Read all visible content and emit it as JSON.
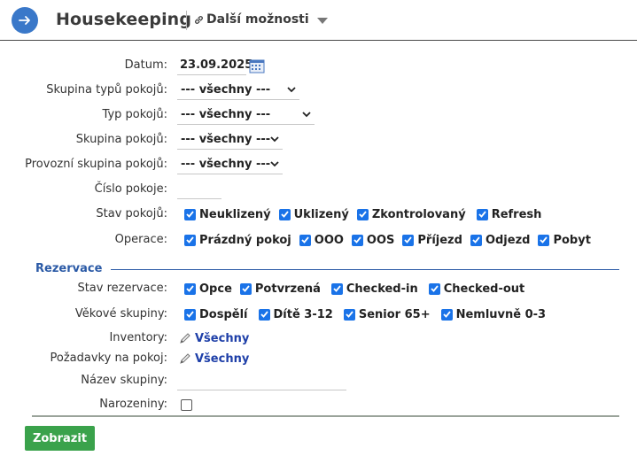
{
  "header": {
    "back_icon": "arrow-right-icon",
    "title": "Housekeeping",
    "more_label": "Další možnosti"
  },
  "filters": {
    "datum": {
      "label": "Datum:",
      "value": "23.09.2025"
    },
    "skupina_typu": {
      "label": "Skupina typů pokojů:",
      "value": "--- všechny ---"
    },
    "typ_pokoju": {
      "label": "Typ pokojů:",
      "value": "--- všechny ---"
    },
    "skupina_pokoju": {
      "label": "Skupina pokojů:",
      "value": "--- všechny ---"
    },
    "provozni_skupina": {
      "label": "Provozní skupina pokojů:",
      "value": "--- všechny ---"
    },
    "cislo_pokoje": {
      "label": "Číslo pokoje:",
      "value": ""
    },
    "stav_pokoju": {
      "label": "Stav pokojů:",
      "options": [
        {
          "label": "Neuklizený",
          "checked": true
        },
        {
          "label": "Uklizený",
          "checked": true
        },
        {
          "label": "Zkontrolovaný",
          "checked": true
        },
        {
          "label": "Refresh",
          "checked": true
        }
      ]
    },
    "operace": {
      "label": "Operace:",
      "options": [
        {
          "label": "Prázdný pokoj",
          "checked": true
        },
        {
          "label": "OOO",
          "checked": true
        },
        {
          "label": "OOS",
          "checked": true
        },
        {
          "label": "Příjezd",
          "checked": true
        },
        {
          "label": "Odjezd",
          "checked": true
        },
        {
          "label": "Pobyt",
          "checked": true
        }
      ]
    }
  },
  "rezervace": {
    "title": "Rezervace",
    "stav_rezervace": {
      "label": "Stav rezervace:",
      "options": [
        {
          "label": "Opce",
          "checked": true
        },
        {
          "label": "Potvrzená",
          "checked": true
        },
        {
          "label": "Checked-in",
          "checked": true
        },
        {
          "label": "Checked-out",
          "checked": true
        }
      ]
    },
    "vekove_skupiny": {
      "label": "Věkové skupiny:",
      "options": [
        {
          "label": "Dospělí",
          "checked": true
        },
        {
          "label": "Dítě 3-12",
          "checked": true
        },
        {
          "label": "Senior 65+",
          "checked": true
        },
        {
          "label": "Nemluvně 0-3",
          "checked": true
        }
      ]
    },
    "inventory": {
      "label": "Inventory:",
      "value": "Všechny"
    },
    "pozadavky": {
      "label": "Požadavky na pokoj:",
      "value": "Všechny"
    },
    "nazev_skupiny": {
      "label": "Název skupiny:",
      "value": ""
    },
    "narozeniny": {
      "label": "Narozeniny:",
      "checked": false
    }
  },
  "submit_label": "Zobrazit",
  "colors": {
    "accent": "#3a78c9",
    "checkbox": "#1a73e8",
    "section": "#2b5aa6",
    "submit": "#3aa24b",
    "link": "#1e3fa8"
  }
}
